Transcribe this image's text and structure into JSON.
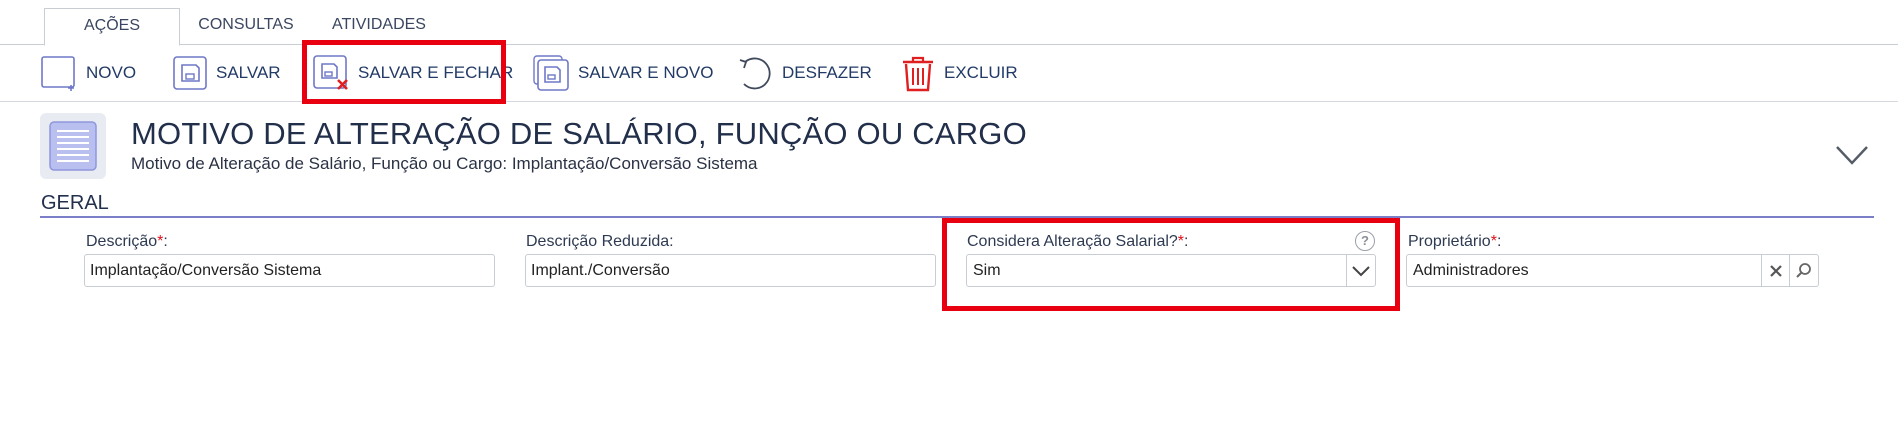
{
  "tabs": [
    {
      "label": "AÇÕES",
      "active": true
    },
    {
      "label": "CONSULTAS",
      "active": false
    },
    {
      "label": "ATIVIDADES",
      "active": false
    }
  ],
  "toolbar": {
    "novo": "NOVO",
    "salvar": "SALVAR",
    "salvar_fechar": "SALVAR E FECHAR",
    "salvar_novo": "SALVAR E NOVO",
    "desfazer": "DESFAZER",
    "excluir": "EXCLUIR"
  },
  "header": {
    "title": "MOTIVO DE ALTERAÇÃO DE SALÁRIO, FUNÇÃO OU CARGO",
    "subtitle": "Motivo de Alteração de Salário, Função ou Cargo: Implantação/Conversão Sistema"
  },
  "section": {
    "title": "GERAL"
  },
  "fields": {
    "descricao": {
      "label": "Descrição",
      "required_mark": "*",
      "suffix": ":",
      "value": "Implantação/Conversão Sistema"
    },
    "descricao_reduzida": {
      "label": "Descrição Reduzida:",
      "value": "Implant./Conversão"
    },
    "considera": {
      "label": "Considera Alteração Salarial?",
      "required_mark": "*",
      "suffix": ":",
      "value": "Sim",
      "help": "?"
    },
    "proprietario": {
      "label": "Proprietário",
      "required_mark": "*",
      "suffix": ":",
      "value": "Administradores"
    }
  },
  "colors": {
    "accent": "#7a7fc8",
    "highlight": "#e80010",
    "delete": "#e02020",
    "required": "#e0101a"
  },
  "icons": [
    "new-doc-icon",
    "save-icon",
    "save-close-icon",
    "save-new-icon",
    "undo-icon",
    "trash-icon",
    "document-icon",
    "chevron-down-icon",
    "help-icon",
    "clear-icon",
    "search-icon"
  ]
}
